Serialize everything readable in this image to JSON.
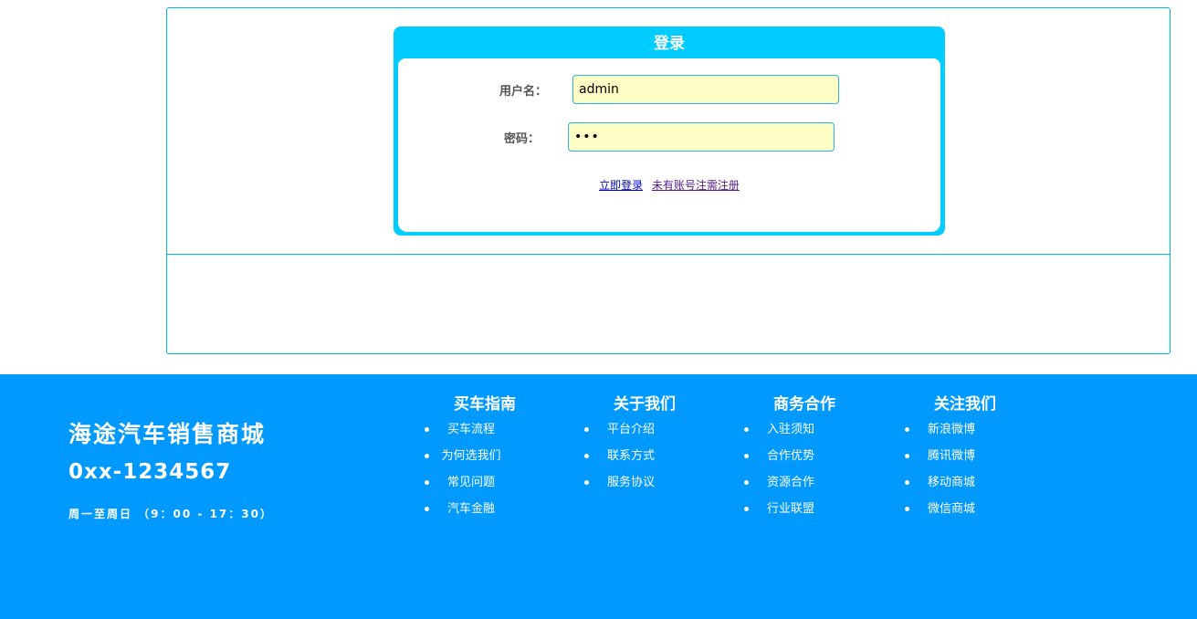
{
  "login": {
    "title": "登录",
    "username_label": "用户名：",
    "username_value": "admin",
    "password_label": "密码：",
    "password_value": "•••",
    "login_link": "立即登录",
    "register_link": "未有账号注需注册"
  },
  "footer": {
    "brand_name": "海途汽车销售商城",
    "phone": "0xx-1234567",
    "hours": "周一至周日 （9：00 - 17：30）",
    "columns": [
      {
        "title": "买车指南",
        "items": [
          "买车流程",
          "为何选我们",
          "常见问题",
          "汽车金融"
        ]
      },
      {
        "title": "关于我们",
        "items": [
          "平台介绍",
          "联系方式",
          "服务协议"
        ]
      },
      {
        "title": "商务合作",
        "items": [
          "入驻须知",
          "合作优势",
          "资源合作",
          "行业联盟"
        ]
      },
      {
        "title": "关注我们",
        "items": [
          "新浪微博",
          "腾讯微博",
          "移动商城",
          "微信商城"
        ]
      }
    ]
  },
  "colors": {
    "accent": "#00ccff",
    "footer_bg": "#0099ff",
    "input_bg": "#fcfcc4",
    "frame_border": "#00b7e8"
  }
}
